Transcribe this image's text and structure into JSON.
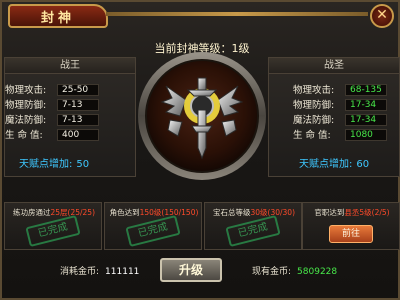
{
  "window": {
    "title": "封神",
    "close_glyph": "✕"
  },
  "level_line": "当前封神等级：1级",
  "left_panel": {
    "title": "战王",
    "stats": [
      {
        "label": "物理攻击:",
        "value": "25-50"
      },
      {
        "label": "物理防御:",
        "value": "7-13"
      },
      {
        "label": "魔法防御:",
        "value": "7-13"
      },
      {
        "label": "生 命 值:",
        "value": "400"
      }
    ],
    "talent_label": "天赋点增加:",
    "talent_value": "50"
  },
  "right_panel": {
    "title": "战圣",
    "stats": [
      {
        "label": "物理攻击:",
        "value": "68-135"
      },
      {
        "label": "物理防御:",
        "value": "17-34"
      },
      {
        "label": "魔法防御:",
        "value": "17-34"
      },
      {
        "label": "生 命 值:",
        "value": "1080"
      }
    ],
    "talent_label": "天赋点增加:",
    "talent_value": "60"
  },
  "tasks": [
    {
      "prefix": "练功房通过",
      "highlight": "25层(25/25)",
      "state": "已完成"
    },
    {
      "prefix": "角色达到",
      "highlight": "150级(150/150)",
      "state": "已完成"
    },
    {
      "prefix": "宝石总等级",
      "highlight": "30级(30/30)",
      "state": "已完成"
    },
    {
      "prefix": "官职达到",
      "highlight": "县丞5级(2/5)",
      "button": "前往"
    }
  ],
  "bottom": {
    "cost_label": "消耗金币:",
    "cost_value": "111111",
    "upgrade_label": "升级",
    "have_label": "现有金币:",
    "have_value": "5809228"
  },
  "colors": {
    "accent_gold": "#c89a4a",
    "stat_green": "#48e84a",
    "talent_blue": "#3ec8ff",
    "task_red": "#ff4a2a",
    "stamp_green": "#3aa85a"
  },
  "icons": {
    "close": "close-icon",
    "emblem": "winged-sword-emblem-icon"
  }
}
